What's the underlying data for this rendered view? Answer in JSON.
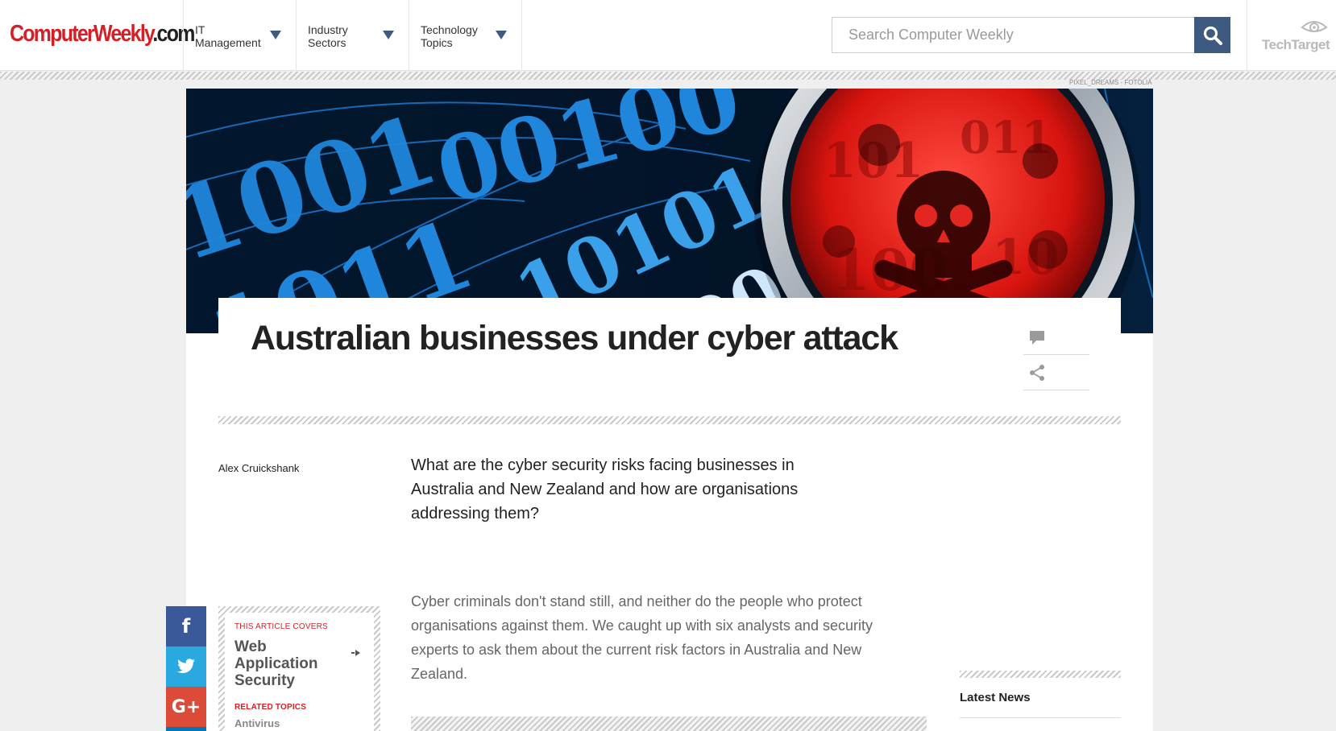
{
  "header": {
    "logo_main": "ComputerWeekly",
    "logo_suffix": ".com",
    "nav": [
      {
        "label": "IT Management"
      },
      {
        "label": "Industry Sectors"
      },
      {
        "label": "Technology Topics"
      }
    ],
    "search_placeholder": "Search Computer Weekly",
    "partner_logo": "TechTarget"
  },
  "hero": {
    "image_credit": "PIXEL_DREAMS - FOTOLIA",
    "image_subject": "binary code and red skull-and-crossbones",
    "colors": {
      "blue": "#1976d2",
      "red": "#e0201c",
      "dark": "#02101f"
    }
  },
  "article": {
    "title": "Australian businesses under cyber attack",
    "author": "Alex Cruickshank",
    "lede": "What are the cyber security risks facing businesses in Australia and New Zealand and how are organisations addressing them?",
    "body": "Cyber criminals don't stand still, and neither do the people who protect organisations against them. We caught up with six analysts and security experts to ask them about the current risk factors in Australia and New Zealand."
  },
  "covers": {
    "label": "THIS ARTICLE COVERS",
    "topic": "Web Application Security",
    "related_label": "RELATED TOPICS",
    "related": [
      "Antivirus"
    ]
  },
  "social": {
    "facebook_glyph": "f",
    "googleplus_glyph": "G+"
  },
  "sidebar": {
    "latest_news": "Latest News"
  },
  "icons": [
    "search-icon",
    "comment-icon",
    "share-icon",
    "facebook-icon",
    "twitter-icon",
    "google-plus-icon",
    "techtarget-eye-icon"
  ],
  "colors": {
    "brand_red": "#d32027",
    "nav_blue": "#3f5a80",
    "facebook": "#3b5998",
    "twitter": "#2aa9e0",
    "googleplus": "#dc4a38"
  }
}
